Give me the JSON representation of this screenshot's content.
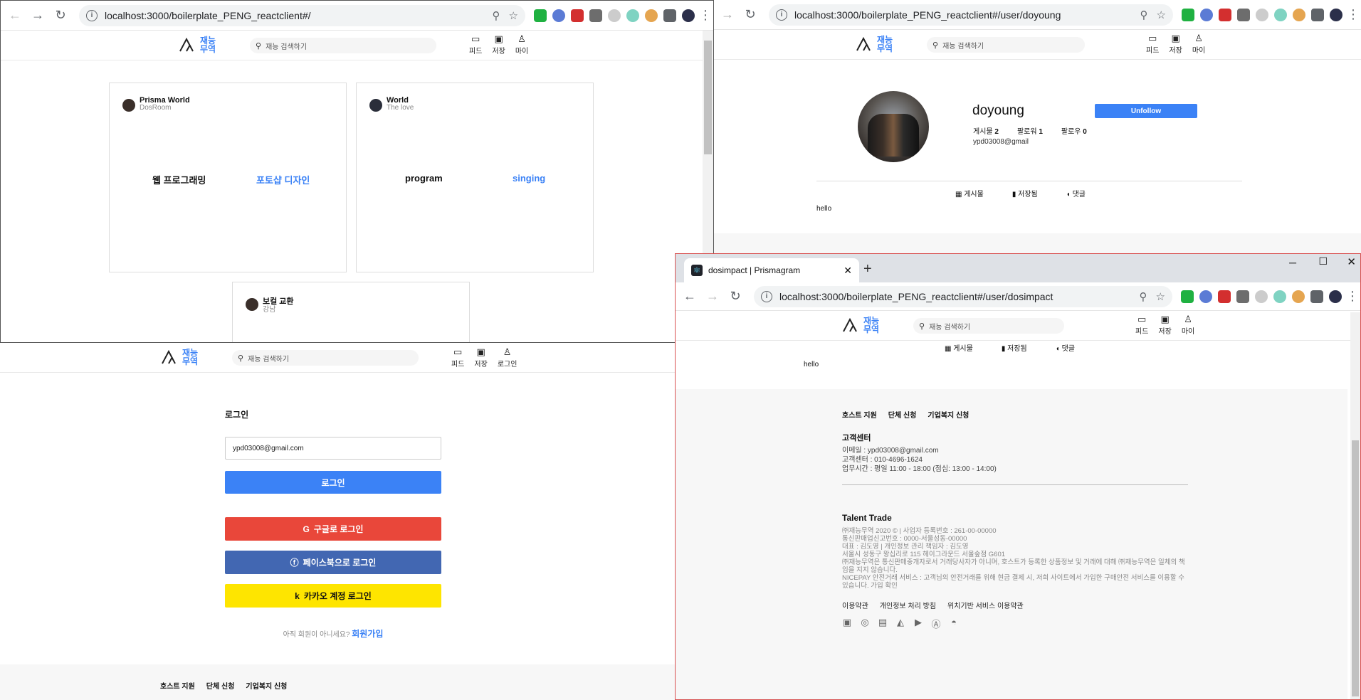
{
  "window1": {
    "url": "localhost:3000/boilerplate_PENG_reactclient#/",
    "search_placeholder": "재능 검색하기",
    "logo_line1": "재능",
    "logo_line2": "무역",
    "nav": [
      "피드",
      "저장",
      "마이"
    ],
    "cards": [
      {
        "name": "Prisma World",
        "sub": "DosRoom",
        "skill_left": "웹 프로그래밍",
        "skill_right": "포토샵 디자인"
      },
      {
        "name": "World",
        "sub": "The love",
        "skill_left": "program",
        "skill_right": "singing"
      },
      {
        "name": "보컬 교환",
        "sub": "강남"
      }
    ]
  },
  "window2": {
    "url": "localhost:3000/boilerplate_PENG_reactclient#/user/doyoung",
    "search_placeholder": "재능 검색하기",
    "nav": [
      "피드",
      "저장",
      "마이"
    ],
    "username": "doyoung",
    "unfollow_label": "Unfollow",
    "stats": [
      {
        "label": "게시물",
        "value": "2"
      },
      {
        "label": "팔로워",
        "value": "1"
      },
      {
        "label": "팔로우",
        "value": "0"
      }
    ],
    "email": "ypd03008@gmail",
    "tabs": [
      "게시물",
      "저장됨",
      "댓글"
    ],
    "post": "hello"
  },
  "window3": {
    "search_placeholder": "재능 검색하기",
    "nav": [
      "피드",
      "저장",
      "로그인"
    ],
    "title": "로그인",
    "email_value": "ypd03008@gmail.com",
    "login_label": "로그인",
    "google_label": "구글로 로그인",
    "facebook_label": "페이스북으로 로그인",
    "kakao_label": "카카오 계정 로그인",
    "signup_prompt": "아직 회원이 아니세요?",
    "signup_link": "회원가입",
    "footer_links": [
      "호스트 지원",
      "단체 신청",
      "기업복지 신청"
    ]
  },
  "window4": {
    "tab_title": "dosimpact | Prismagram",
    "url": "localhost:3000/boilerplate_PENG_reactclient#/user/dosimpact",
    "search_placeholder": "재능 검색하기",
    "nav": [
      "피드",
      "저장",
      "마이"
    ],
    "tabs": [
      "게시물",
      "저장됨",
      "댓글"
    ],
    "post": "hello",
    "footer_links": [
      "호스트 지원",
      "단체 신청",
      "기업복지 신청"
    ],
    "cs_title": "고객센터",
    "cs_lines": [
      "이메일 : ypd03008@gmail.com",
      "고객센터 : 010-4696-1624",
      "업무시간 : 평일 11:00 - 18:00 (점심: 13:00 - 14:00)"
    ],
    "company_title": "Talent Trade",
    "company_lines": [
      "㈜재능무역 2020 © | 사업자 등록번호 : 261-00-00000",
      "통신판매업신고번호 : 0000-서울성동-00000",
      "대표 : 김도영 | 개인정보 관리 책임자 : 김도영",
      "서울시 성동구 왕십리로 115 헤이그라운드 서울숲점 G601",
      "㈜재능무역은 통신판매중개자로서 거래당사자가 아니며, 호스트가 등록한 상품정보 및 거래에 대해 ㈜재능무역은 일체의 책임을 지지 않습니다.",
      "NICEPAY 안전거래 서비스 : 고객님의 안전거래를 위해 현금 결제 시, 저희 사이트에서 가입한 구매안전 서비스를 이용할 수 있습니다. 가입 확인"
    ],
    "policy_links": [
      "이용약관",
      "개인정보 처리 방침",
      "위치기반 서비스 이용약관"
    ],
    "social_icons": [
      "facebook-icon",
      "instagram-icon",
      "twitch-icon",
      "twitter-icon",
      "youtube-icon",
      "appstore-icon",
      "android-icon"
    ]
  },
  "colors": {
    "accent": "#3b82f6",
    "google": "#e9473a",
    "facebook": "#4267b2",
    "kakao": "#fee500"
  }
}
